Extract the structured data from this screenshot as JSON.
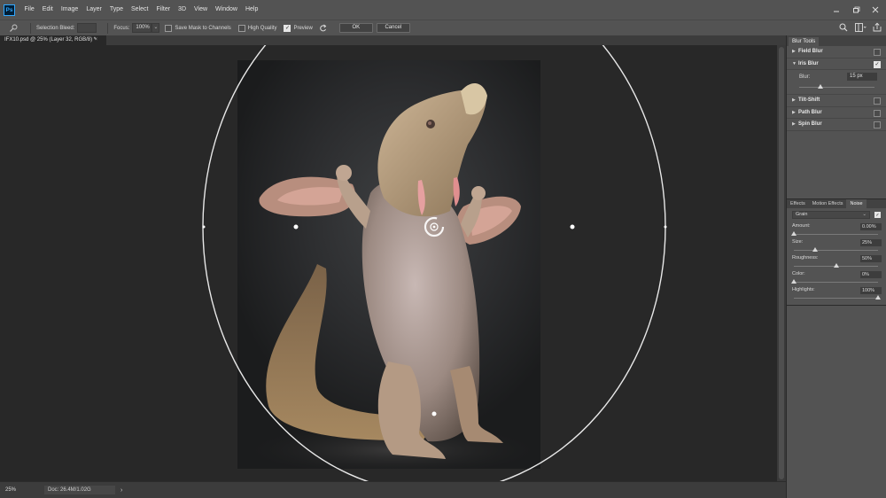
{
  "menubar": {
    "logo": "Ps",
    "items": [
      "File",
      "Edit",
      "Image",
      "Layer",
      "Type",
      "Select",
      "Filter",
      "3D",
      "View",
      "Window",
      "Help"
    ]
  },
  "options": {
    "selection_bleed_label": "Selection Bleed:",
    "focus_label": "Focus:",
    "focus_value": "100%",
    "save_mask_label": "Save Mask to Channels",
    "high_quality_label": "High Quality",
    "preview_label": "Preview",
    "ok_label": "OK",
    "cancel_label": "Cancel"
  },
  "document_tab": {
    "title": "IFX10.psd @ 25% (Layer 32, RGB/8) *",
    "close": "×"
  },
  "status": {
    "zoom": "25%",
    "doc_info": "Doc: 26.4M/1.02G",
    "arrow": "›"
  },
  "blur_gallery": {
    "tab": "Blur Tools",
    "rows": [
      {
        "name": "Field Blur",
        "expanded": false,
        "checked": false
      },
      {
        "name": "Iris Blur",
        "expanded": true,
        "checked": true
      },
      {
        "name": "Tilt-Shift",
        "expanded": false,
        "checked": false
      },
      {
        "name": "Path Blur",
        "expanded": false,
        "checked": false
      },
      {
        "name": "Spin Blur",
        "expanded": false,
        "checked": false
      }
    ],
    "iris": {
      "blur_label": "Blur:",
      "blur_value": "15 px",
      "blur_fraction": 0.28
    }
  },
  "effects_panel": {
    "tabs": [
      "Effects",
      "Motion Effects",
      "Noise"
    ],
    "active_tab": "Noise",
    "noise_type": "Grain",
    "rows": [
      {
        "label": "Amount:",
        "value": "0.00%",
        "fraction": 0.0
      },
      {
        "label": "Size:",
        "value": "25%",
        "fraction": 0.25
      },
      {
        "label": "Roughness:",
        "value": "50%",
        "fraction": 0.5
      },
      {
        "label": "Color:",
        "value": "0%",
        "fraction": 0.0
      },
      {
        "label": "Highlights:",
        "value": "100%",
        "fraction": 1.0
      }
    ]
  },
  "colors": {
    "chrome": "#535353",
    "canvas_bg": "#282828",
    "accent": "#31a8ff"
  }
}
